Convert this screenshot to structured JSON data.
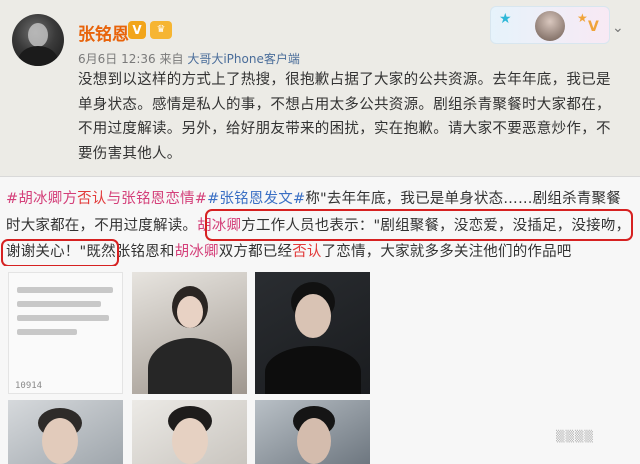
{
  "post": {
    "username": "张铭恩",
    "badge_v": "V",
    "badge_vip": "♛",
    "date": "6月6日 12:36",
    "source_prefix": "来自",
    "source": "大哥大iPhone客户端",
    "text": "没想到以这样的方式上了热搜，很抱歉占据了大家的公共资源。去年年底，我已是单身状态。感情是私人的事，不想占用太多公共资源。剧组杀青聚餐时大家都在，不用过度解读。另外，给好朋友带来的困扰，实在抱歉。请大家不要恶意炒作，不要伤害其他人。",
    "more_icon": "chevron-down-icon"
  },
  "article": {
    "tag1_a": "#胡冰卿",
    "tag1_b": "方",
    "tag1_c": "否认",
    "tag1_d": "与张铭恩恋情#",
    "tag2": "#张铭恩发文#",
    "seg1": "称\"去年年底，我已是单身状态……剧组杀青聚餐时大家都在，不用过度解读。",
    "name1": "胡冰卿",
    "seg2": "方工作人员也表示：\"剧组聚餐，没恋爱，没插足，没接吻，谢谢关心！",
    "seg3": "\"既然张铭恩和",
    "name2": "胡冰卿",
    "seg4": "双方都已经",
    "deny": "否认",
    "seg5": "了恋情，大家就多多关注他们的作品吧"
  },
  "thumb_caption": "10914",
  "colors": {
    "username": "#e8630a",
    "tag_pink": "#d4407a",
    "tag_blue": "#3a6fc4",
    "highlight_red": "#d62121"
  }
}
